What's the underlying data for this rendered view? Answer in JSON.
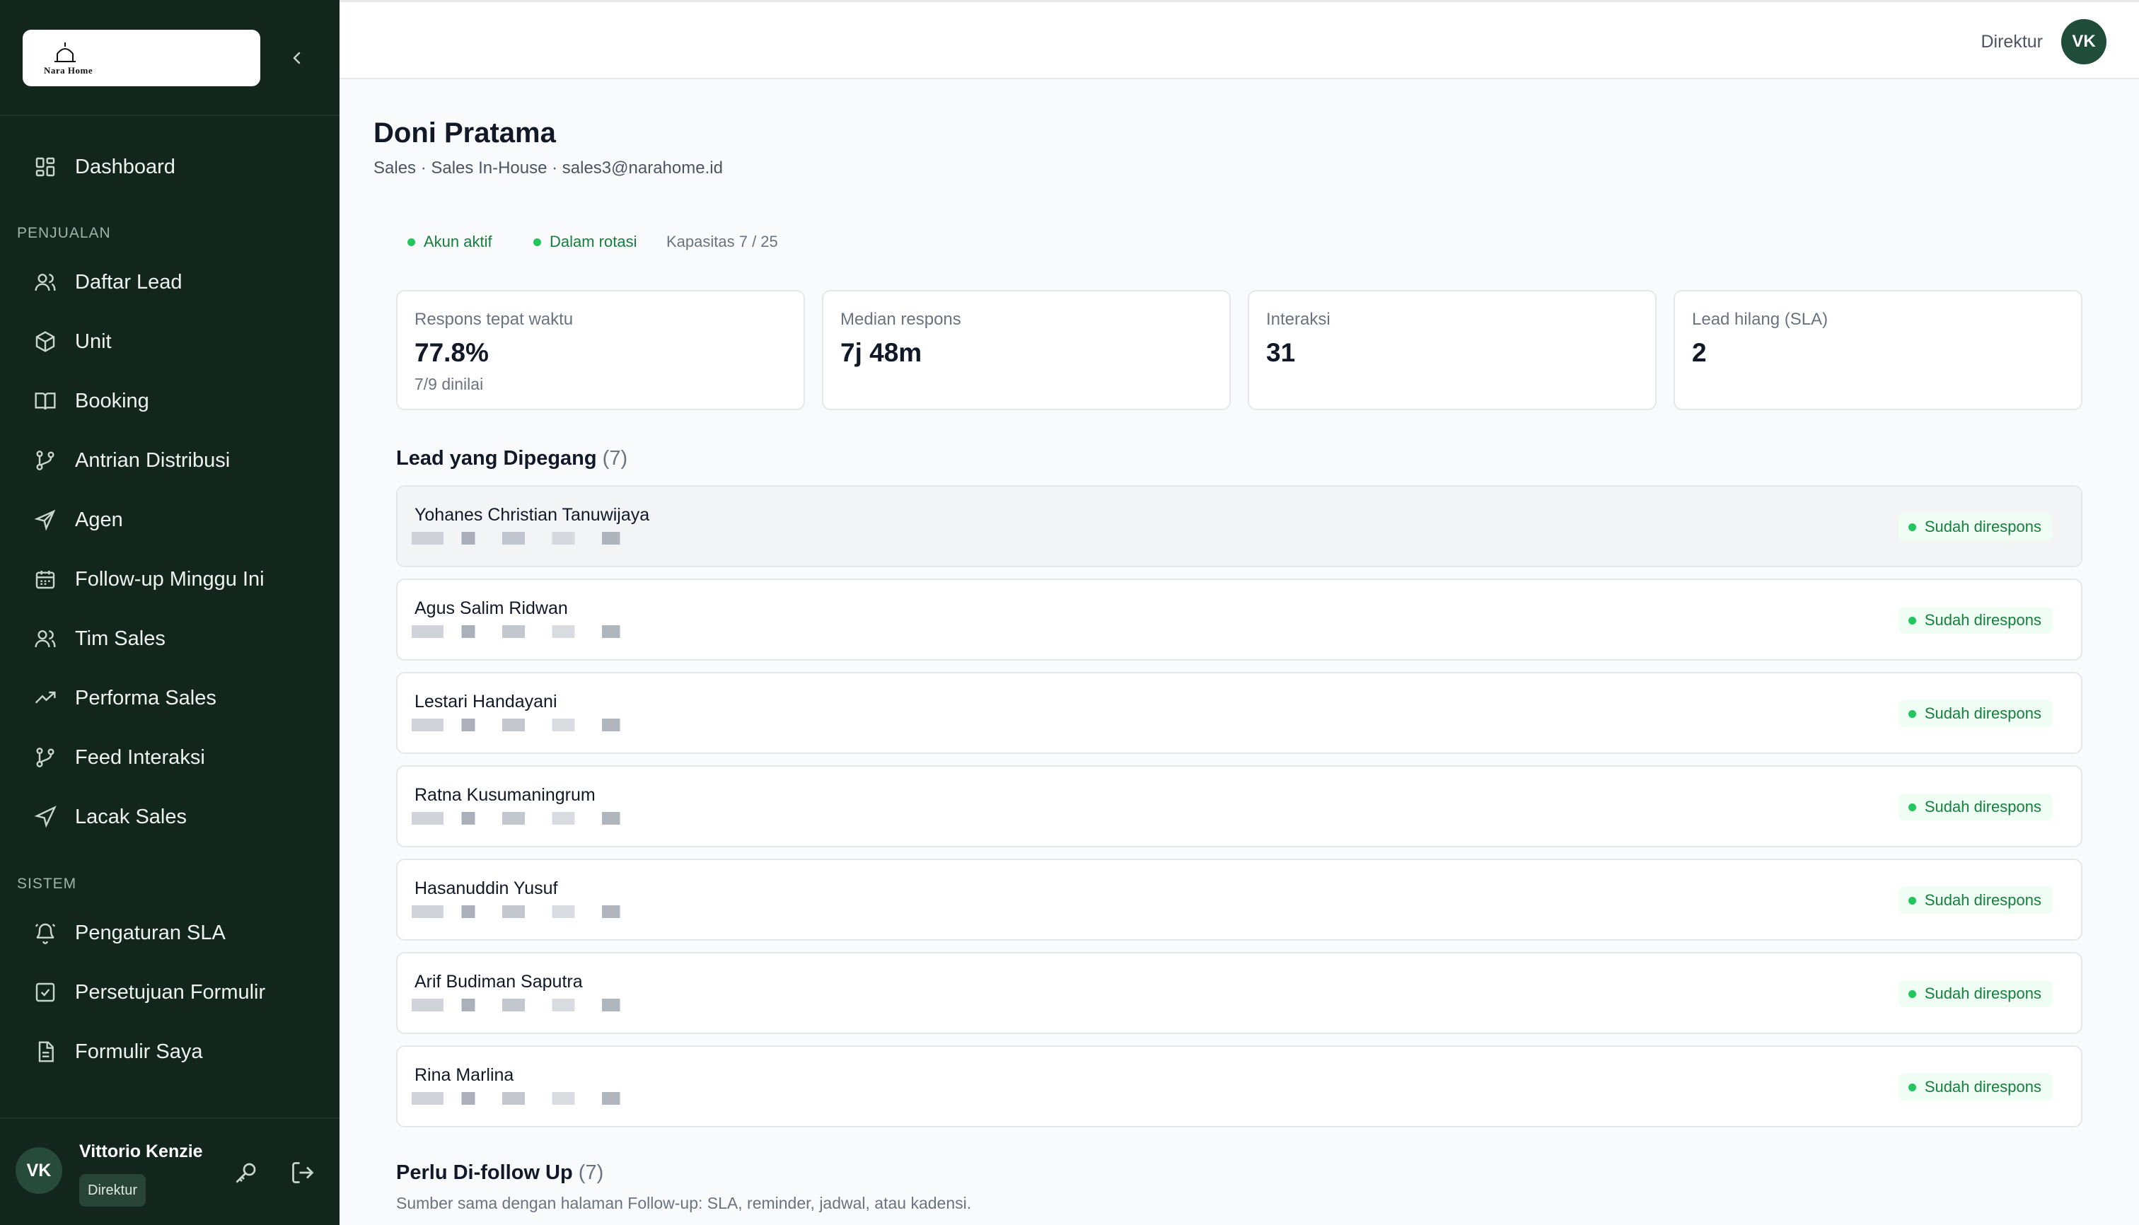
{
  "brand": {
    "name": "Nara Home"
  },
  "nav": {
    "dashboard": "Dashboard",
    "section_penjualan": "PENJUALAN",
    "items_penjualan": [
      {
        "label": "Daftar Lead",
        "icon": "users-icon"
      },
      {
        "label": "Unit",
        "icon": "box-icon"
      },
      {
        "label": "Booking",
        "icon": "book-icon"
      },
      {
        "label": "Antrian Distribusi",
        "icon": "branch-icon"
      },
      {
        "label": "Agen",
        "icon": "send-icon"
      },
      {
        "label": "Follow-up Minggu Ini",
        "icon": "calendar-icon"
      },
      {
        "label": "Tim Sales",
        "icon": "users-icon"
      },
      {
        "label": "Performa Sales",
        "icon": "trending-up-icon"
      },
      {
        "label": "Feed Interaksi",
        "icon": "branch-icon"
      },
      {
        "label": "Lacak Sales",
        "icon": "navigation-icon"
      }
    ],
    "section_sistem": "SISTEM",
    "items_sistem": [
      {
        "label": "Pengaturan SLA",
        "icon": "bell-icon"
      },
      {
        "label": "Persetujuan Formulir",
        "icon": "check-square-icon"
      },
      {
        "label": "Formulir Saya",
        "icon": "file-icon"
      }
    ]
  },
  "sidebar_user": {
    "initials": "VK",
    "name": "Vittorio Kenzie",
    "role": "Direktur"
  },
  "topbar": {
    "role": "Direktur",
    "initials": "VK"
  },
  "profile": {
    "name": "Doni Pratama",
    "subtitle": "Sales · Sales In-House · sales3@narahome.id",
    "status_active": "Akun aktif",
    "status_rotation": "Dalam rotasi",
    "capacity": "Kapasitas 7 / 25"
  },
  "stats": [
    {
      "label": "Respons tepat waktu",
      "value": "77.8%",
      "sub": "7/9 dinilai"
    },
    {
      "label": "Median respons",
      "value": "7j 48m",
      "sub": ""
    },
    {
      "label": "Interaksi",
      "value": "31",
      "sub": ""
    },
    {
      "label": "Lead hilang (SLA)",
      "value": "2",
      "sub": ""
    }
  ],
  "leads_section": {
    "title": "Lead yang Dipegang",
    "count": "(7)"
  },
  "leads": [
    {
      "name": "Yohanes Christian Tanuwijaya",
      "status": "Sudah direspons"
    },
    {
      "name": "Agus Salim Ridwan",
      "status": "Sudah direspons"
    },
    {
      "name": "Lestari Handayani",
      "status": "Sudah direspons"
    },
    {
      "name": "Ratna Kusumaningrum",
      "status": "Sudah direspons"
    },
    {
      "name": "Hasanuddin Yusuf",
      "status": "Sudah direspons"
    },
    {
      "name": "Arif Budiman Saputra",
      "status": "Sudah direspons"
    },
    {
      "name": "Rina Marlina",
      "status": "Sudah direspons"
    }
  ],
  "followup_section": {
    "title": "Perlu Di-follow Up",
    "count": "(7)",
    "subtitle": "Sumber sama dengan halaman Follow-up: SLA, reminder, jadwal, atau kadensi."
  },
  "colors": {
    "sidebar": "#13261e",
    "accent": "#15803d",
    "status_dot": "#22c55e"
  }
}
